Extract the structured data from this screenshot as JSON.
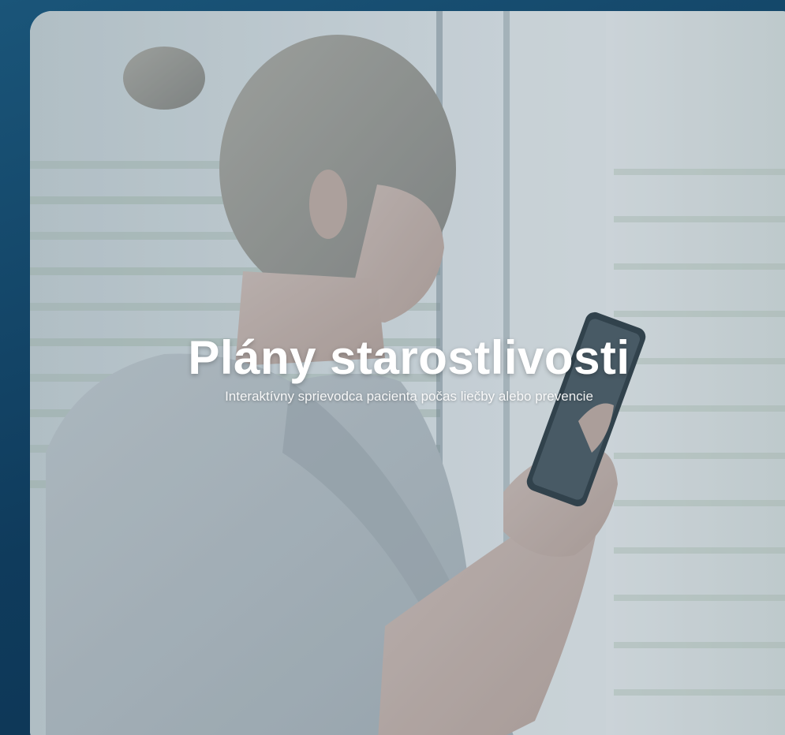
{
  "hero": {
    "title": "Plány starostlivosti",
    "subtitle": "Interaktívny sprievodca pacienta počas liečby alebo prevencie"
  },
  "colors": {
    "background": "#14476a",
    "text": "#ffffff"
  }
}
